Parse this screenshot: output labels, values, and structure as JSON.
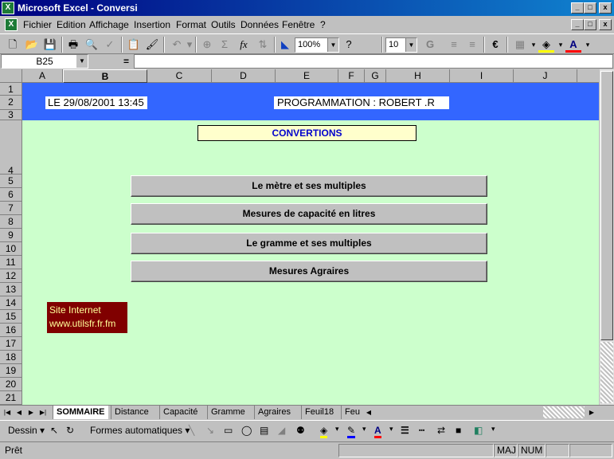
{
  "window": {
    "title": "Microsoft Excel - Conversi",
    "controls": [
      "_",
      "□",
      "x"
    ]
  },
  "menu": {
    "items": [
      "Fichier",
      "Edition",
      "Affichage",
      "Insertion",
      "Format",
      "Outils",
      "Données",
      "Fenêtre",
      "?"
    ],
    "doc_controls": [
      "_",
      "□",
      "x"
    ]
  },
  "toolbar": {
    "zoom": "100%",
    "font_size": "10",
    "euro_label": "€"
  },
  "formula_bar": {
    "cell_ref": "B25",
    "equals": "="
  },
  "sheet": {
    "columns": [
      "A",
      "B",
      "C",
      "D",
      "E",
      "F",
      "G",
      "H",
      "I",
      "J"
    ],
    "rows": [
      "1",
      "2",
      "3",
      "4",
      "5",
      "6",
      "7",
      "8",
      "9",
      "10",
      "11",
      "12",
      "13",
      "14",
      "15",
      "16",
      "17",
      "18",
      "19",
      "20",
      "21"
    ],
    "date_cell": "LE  29/08/2001 13:45",
    "author_cell": "PROGRAMMATION :     ROBERT .R",
    "title": "CONVERTIONS",
    "buttons": [
      "Le mètre et ses multiples",
      "Mesures de capacité en litres",
      "Le gramme et ses multiples",
      "Mesures Agraires"
    ],
    "site_label": "Site Internet",
    "site_url": "www.utilsfr.fr.fm"
  },
  "tabs": {
    "items": [
      "SOMMAIRE",
      "Distance",
      "Capacité",
      "Gramme",
      "Agraires",
      "Feuil18",
      "Feu"
    ],
    "active_index": 0
  },
  "drawing": {
    "dessin": "Dessin ▾",
    "formes": "Formes automatiques ▾"
  },
  "status": {
    "ready": "Prêt",
    "caps": "MAJ",
    "num": "NUM"
  },
  "colors": {
    "band": "#3366ff",
    "sheet_bg": "#ccffcc",
    "title_fg": "#0000cc",
    "site_bg": "#800000"
  }
}
